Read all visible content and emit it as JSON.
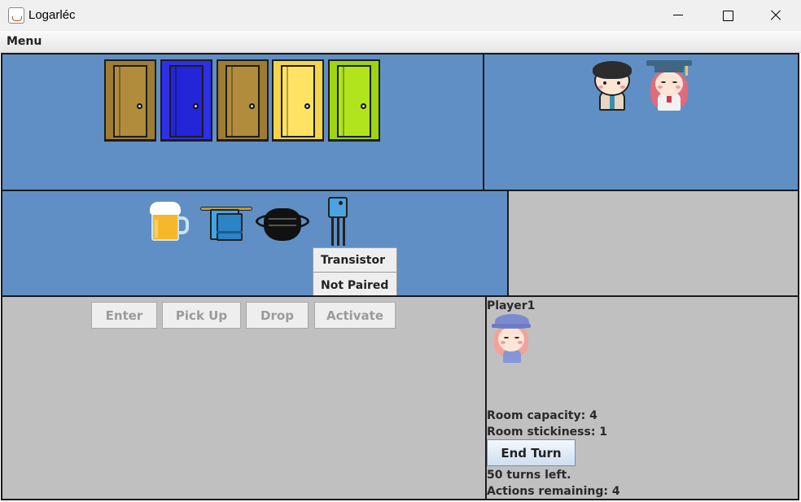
{
  "window": {
    "title": "Logarléc"
  },
  "menubar": {
    "menu_label": "Menu"
  },
  "doors": [
    {
      "name": "door-gold-1",
      "color": "#b08c3c",
      "frame": "#9e7c32"
    },
    {
      "name": "door-blue",
      "color": "#2424d8",
      "frame": "#2f2fe6"
    },
    {
      "name": "door-gold-2",
      "color": "#b08c3c",
      "frame": "#9e7c32"
    },
    {
      "name": "door-yellow",
      "color": "#fde264",
      "frame": "#f4d54a"
    },
    {
      "name": "door-lime",
      "color": "#b1e41d",
      "frame": "#9ed414"
    }
  ],
  "room_characters": [
    "student-boy-icon",
    "student-girl-graduate-icon"
  ],
  "items": [
    "beer-mug-icon",
    "towel-icon",
    "face-mask-icon",
    "transistor-icon"
  ],
  "popup": {
    "title": "Transistor",
    "status": "Not Paired"
  },
  "actions": {
    "enter": "Enter",
    "pick_up": "Pick Up",
    "drop": "Drop",
    "activate": "Activate"
  },
  "player": {
    "name": "Player1",
    "avatar": "player-avatar-icon",
    "room_capacity": "Room capacity: 4",
    "room_stickiness": "Room stickiness: 1",
    "end_turn": "End Turn",
    "turns_left": "50 turns left.",
    "actions_remaining": "Actions remaining: 4"
  },
  "colors": {
    "panel_blue": "#5f8fc5",
    "panel_gray": "#c0c0c0"
  }
}
